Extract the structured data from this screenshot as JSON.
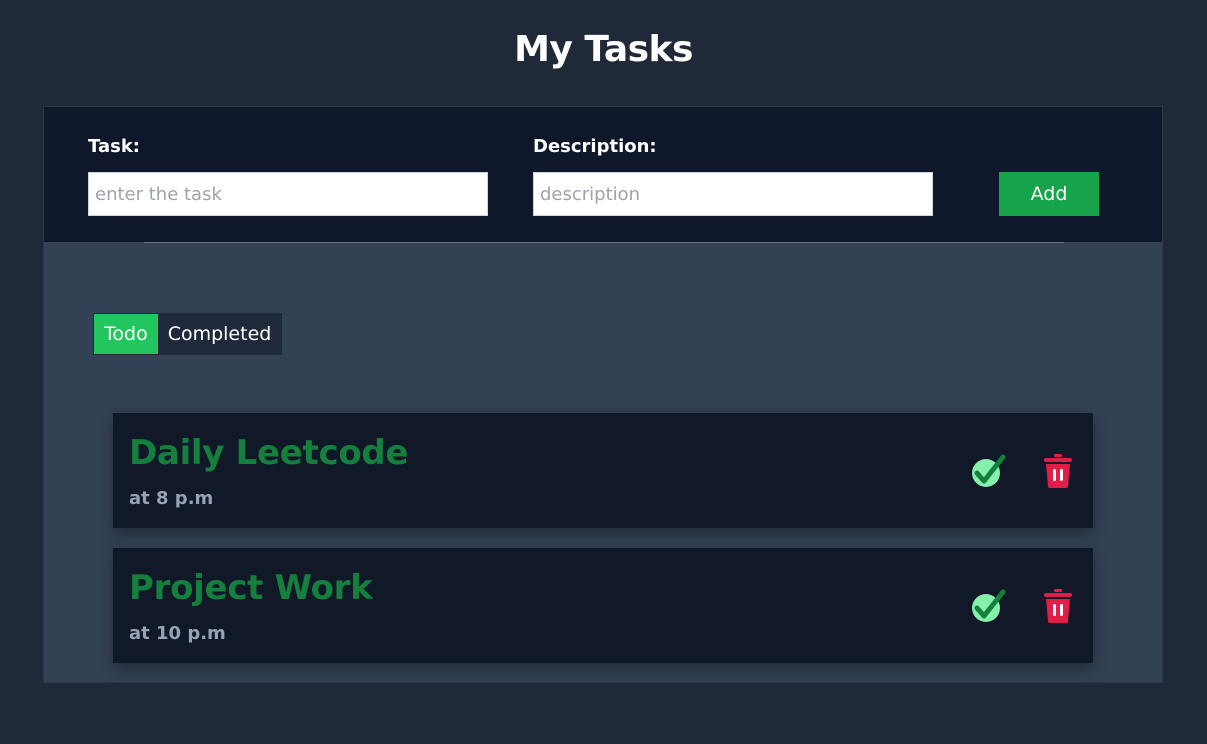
{
  "page": {
    "title": "My Tasks"
  },
  "form": {
    "task_label": "Task:",
    "task_placeholder": "enter the task",
    "description_label": "Description:",
    "description_placeholder": "description",
    "add_label": "Add"
  },
  "tabs": [
    {
      "label": "Todo",
      "active": true
    },
    {
      "label": "Completed",
      "active": false
    }
  ],
  "tasks": [
    {
      "title": "Daily Leetcode",
      "description": "at 8 p.m"
    },
    {
      "title": "Project Work",
      "description": "at 10 p.m"
    }
  ],
  "icons": {
    "complete": "check-icon",
    "delete": "trash-icon"
  },
  "colors": {
    "accent": "#22c55e",
    "add_button": "#16a34a",
    "task_title": "#15803d",
    "delete": "#e11d48",
    "check": "#86efac"
  }
}
